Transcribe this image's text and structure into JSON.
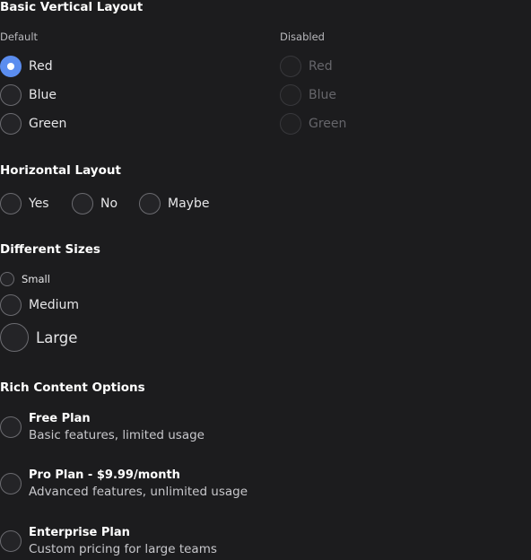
{
  "basic": {
    "title": "Basic Vertical Layout",
    "default_label": "Default",
    "disabled_label": "Disabled",
    "default_options": [
      {
        "label": "Red",
        "checked": true
      },
      {
        "label": "Blue",
        "checked": false
      },
      {
        "label": "Green",
        "checked": false
      }
    ],
    "disabled_options": [
      {
        "label": "Red"
      },
      {
        "label": "Blue"
      },
      {
        "label": "Green"
      }
    ]
  },
  "horizontal": {
    "title": "Horizontal Layout",
    "options": [
      {
        "label": "Yes"
      },
      {
        "label": "No"
      },
      {
        "label": "Maybe"
      }
    ]
  },
  "sizes": {
    "title": "Different Sizes",
    "options": [
      {
        "label": "Small"
      },
      {
        "label": "Medium"
      },
      {
        "label": "Large"
      }
    ]
  },
  "rich": {
    "title": "Rich Content Options",
    "options": [
      {
        "title": "Free Plan",
        "description": "Basic features, limited usage"
      },
      {
        "title": "Pro Plan - $9.99/month",
        "description": "Advanced features, unlimited usage"
      },
      {
        "title": "Enterprise Plan",
        "description": "Custom pricing for large teams"
      }
    ]
  },
  "colors": {
    "accent": "#5b8def",
    "background": "#1c1c1e"
  }
}
